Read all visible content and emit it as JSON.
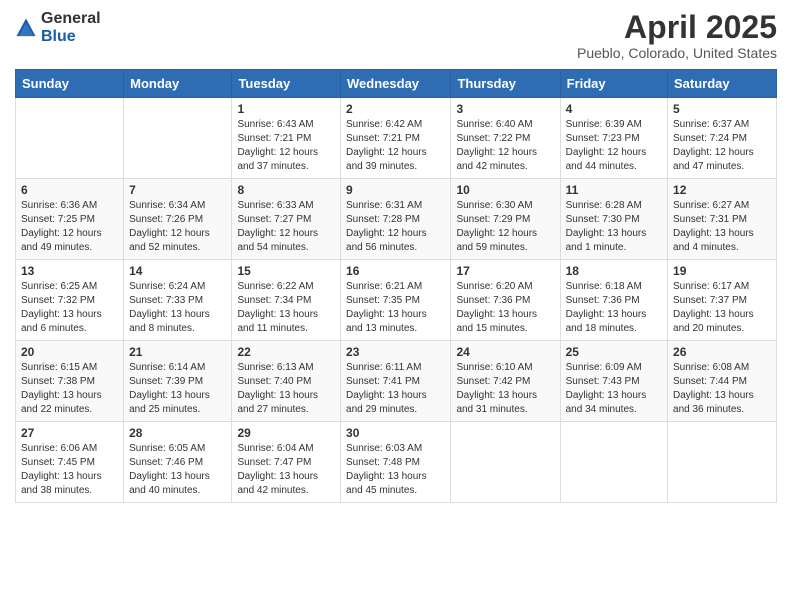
{
  "logo": {
    "general": "General",
    "blue": "Blue"
  },
  "header": {
    "month": "April 2025",
    "location": "Pueblo, Colorado, United States"
  },
  "weekdays": [
    "Sunday",
    "Monday",
    "Tuesday",
    "Wednesday",
    "Thursday",
    "Friday",
    "Saturday"
  ],
  "weeks": [
    [
      {
        "day": "",
        "info": ""
      },
      {
        "day": "",
        "info": ""
      },
      {
        "day": "1",
        "info": "Sunrise: 6:43 AM\nSunset: 7:21 PM\nDaylight: 12 hours and 37 minutes."
      },
      {
        "day": "2",
        "info": "Sunrise: 6:42 AM\nSunset: 7:21 PM\nDaylight: 12 hours and 39 minutes."
      },
      {
        "day": "3",
        "info": "Sunrise: 6:40 AM\nSunset: 7:22 PM\nDaylight: 12 hours and 42 minutes."
      },
      {
        "day": "4",
        "info": "Sunrise: 6:39 AM\nSunset: 7:23 PM\nDaylight: 12 hours and 44 minutes."
      },
      {
        "day": "5",
        "info": "Sunrise: 6:37 AM\nSunset: 7:24 PM\nDaylight: 12 hours and 47 minutes."
      }
    ],
    [
      {
        "day": "6",
        "info": "Sunrise: 6:36 AM\nSunset: 7:25 PM\nDaylight: 12 hours and 49 minutes."
      },
      {
        "day": "7",
        "info": "Sunrise: 6:34 AM\nSunset: 7:26 PM\nDaylight: 12 hours and 52 minutes."
      },
      {
        "day": "8",
        "info": "Sunrise: 6:33 AM\nSunset: 7:27 PM\nDaylight: 12 hours and 54 minutes."
      },
      {
        "day": "9",
        "info": "Sunrise: 6:31 AM\nSunset: 7:28 PM\nDaylight: 12 hours and 56 minutes."
      },
      {
        "day": "10",
        "info": "Sunrise: 6:30 AM\nSunset: 7:29 PM\nDaylight: 12 hours and 59 minutes."
      },
      {
        "day": "11",
        "info": "Sunrise: 6:28 AM\nSunset: 7:30 PM\nDaylight: 13 hours and 1 minute."
      },
      {
        "day": "12",
        "info": "Sunrise: 6:27 AM\nSunset: 7:31 PM\nDaylight: 13 hours and 4 minutes."
      }
    ],
    [
      {
        "day": "13",
        "info": "Sunrise: 6:25 AM\nSunset: 7:32 PM\nDaylight: 13 hours and 6 minutes."
      },
      {
        "day": "14",
        "info": "Sunrise: 6:24 AM\nSunset: 7:33 PM\nDaylight: 13 hours and 8 minutes."
      },
      {
        "day": "15",
        "info": "Sunrise: 6:22 AM\nSunset: 7:34 PM\nDaylight: 13 hours and 11 minutes."
      },
      {
        "day": "16",
        "info": "Sunrise: 6:21 AM\nSunset: 7:35 PM\nDaylight: 13 hours and 13 minutes."
      },
      {
        "day": "17",
        "info": "Sunrise: 6:20 AM\nSunset: 7:36 PM\nDaylight: 13 hours and 15 minutes."
      },
      {
        "day": "18",
        "info": "Sunrise: 6:18 AM\nSunset: 7:36 PM\nDaylight: 13 hours and 18 minutes."
      },
      {
        "day": "19",
        "info": "Sunrise: 6:17 AM\nSunset: 7:37 PM\nDaylight: 13 hours and 20 minutes."
      }
    ],
    [
      {
        "day": "20",
        "info": "Sunrise: 6:15 AM\nSunset: 7:38 PM\nDaylight: 13 hours and 22 minutes."
      },
      {
        "day": "21",
        "info": "Sunrise: 6:14 AM\nSunset: 7:39 PM\nDaylight: 13 hours and 25 minutes."
      },
      {
        "day": "22",
        "info": "Sunrise: 6:13 AM\nSunset: 7:40 PM\nDaylight: 13 hours and 27 minutes."
      },
      {
        "day": "23",
        "info": "Sunrise: 6:11 AM\nSunset: 7:41 PM\nDaylight: 13 hours and 29 minutes."
      },
      {
        "day": "24",
        "info": "Sunrise: 6:10 AM\nSunset: 7:42 PM\nDaylight: 13 hours and 31 minutes."
      },
      {
        "day": "25",
        "info": "Sunrise: 6:09 AM\nSunset: 7:43 PM\nDaylight: 13 hours and 34 minutes."
      },
      {
        "day": "26",
        "info": "Sunrise: 6:08 AM\nSunset: 7:44 PM\nDaylight: 13 hours and 36 minutes."
      }
    ],
    [
      {
        "day": "27",
        "info": "Sunrise: 6:06 AM\nSunset: 7:45 PM\nDaylight: 13 hours and 38 minutes."
      },
      {
        "day": "28",
        "info": "Sunrise: 6:05 AM\nSunset: 7:46 PM\nDaylight: 13 hours and 40 minutes."
      },
      {
        "day": "29",
        "info": "Sunrise: 6:04 AM\nSunset: 7:47 PM\nDaylight: 13 hours and 42 minutes."
      },
      {
        "day": "30",
        "info": "Sunrise: 6:03 AM\nSunset: 7:48 PM\nDaylight: 13 hours and 45 minutes."
      },
      {
        "day": "",
        "info": ""
      },
      {
        "day": "",
        "info": ""
      },
      {
        "day": "",
        "info": ""
      }
    ]
  ]
}
